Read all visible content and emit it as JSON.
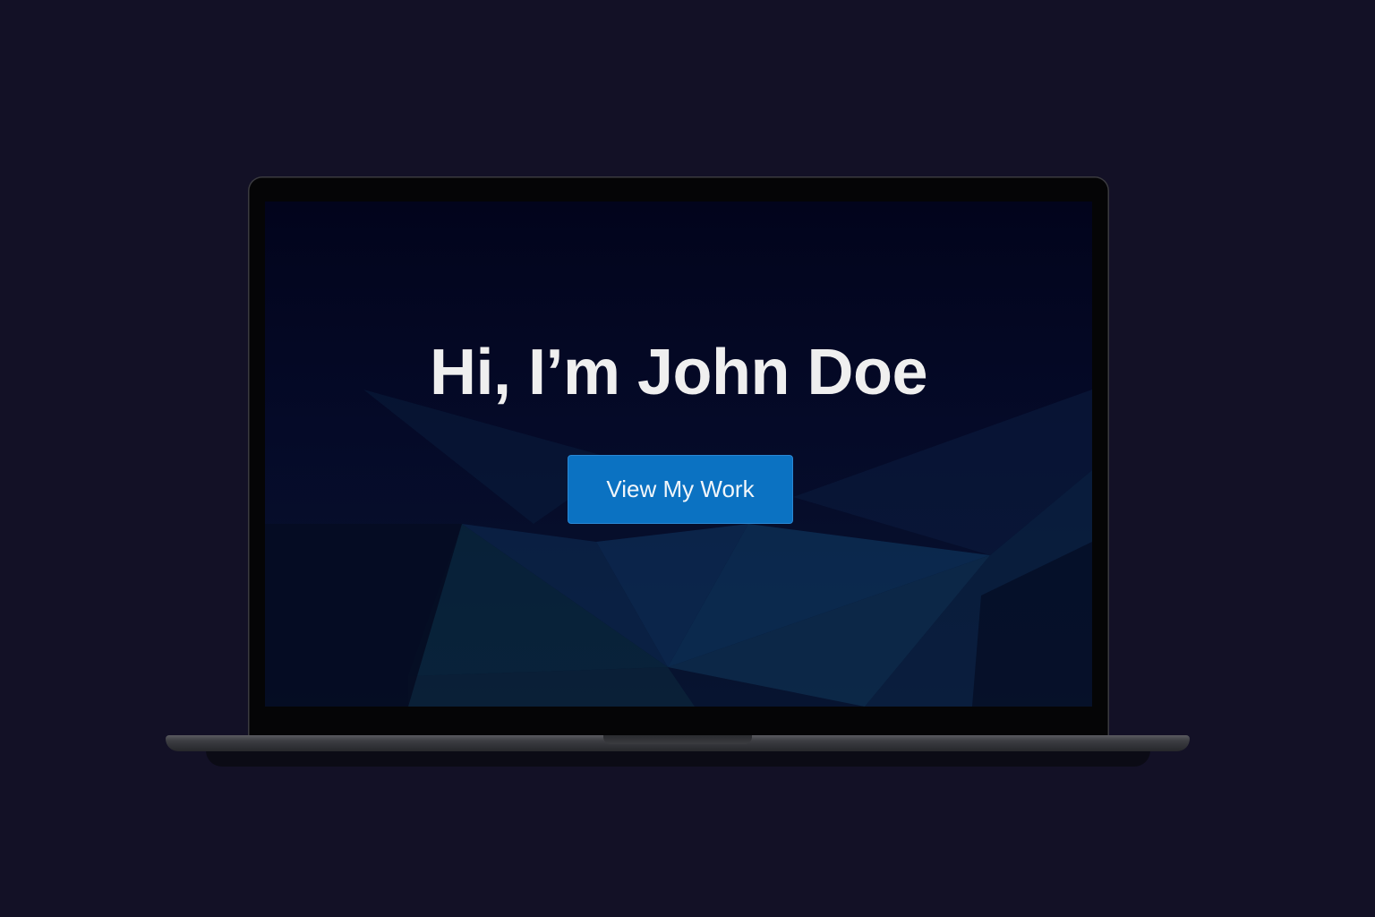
{
  "hero": {
    "title": "Hi, I’m John Doe",
    "button_label": "View My Work"
  },
  "colors": {
    "page_background": "#131126",
    "screen_background": "#02041c",
    "button_background": "#0b72c2",
    "title_text": "#efefef"
  }
}
